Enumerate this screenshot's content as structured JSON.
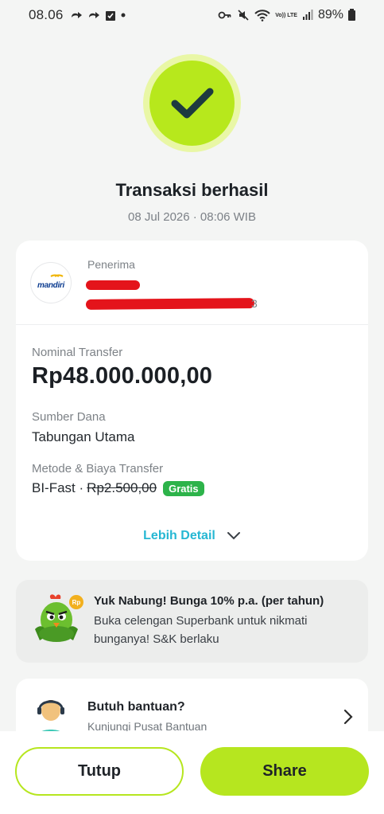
{
  "status_bar": {
    "time": "08.06",
    "battery": "89%",
    "signal_label_1": "Vo)) LTE",
    "signal_label_2": "R"
  },
  "success": {
    "title": "Transaksi berhasil",
    "datetime": "08 Jul 2026 · 08:06 WIB"
  },
  "recipient": {
    "label": "Penerima",
    "bank_logo_text": "mandiri",
    "account_suffix": "3"
  },
  "transfer": {
    "amount_label": "Nominal Transfer",
    "amount": "Rp48.000.000,00",
    "source_label": "Sumber Dana",
    "source": "Tabungan Utama",
    "method_label": "Metode & Biaya Transfer",
    "method": "BI-Fast ·",
    "fee": "Rp2.500,00",
    "fee_badge": "Gratis",
    "more_label": "Lebih Detail"
  },
  "promo": {
    "title": "Yuk Nabung! Bunga 10% p.a. (per tahun)",
    "description": "Buka celengan Superbank untuk nikmati bunganya! S&K berlaku",
    "badge": "Rp"
  },
  "help": {
    "title": "Butuh bantuan?",
    "subtitle": "Kunjungi Pusat Bantuan"
  },
  "actions": {
    "close_label": "Tutup",
    "share_label": "Share"
  },
  "colors": {
    "accent": "#b6e61f",
    "link": "#25b7d3",
    "badge_green": "#2db34a",
    "redaction": "#e4141b"
  }
}
